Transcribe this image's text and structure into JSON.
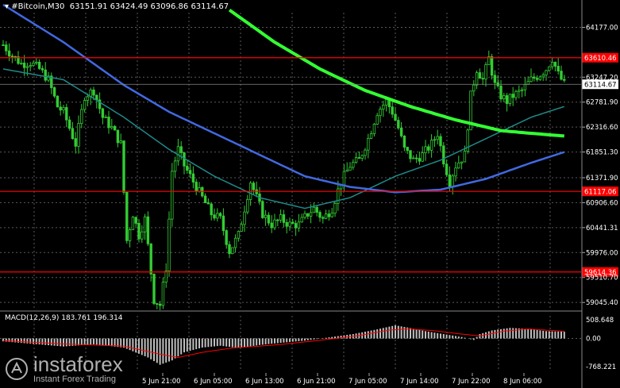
{
  "header": {
    "symbol": "▾ #Bitcoin,M30",
    "ohlc": "63151.91 63424.49 63096.86 63114.67"
  },
  "macd": {
    "label": "MACD(12,26,9)",
    "values": "183.761 196.314"
  },
  "watermark": {
    "brand": "instaforex",
    "tagline": "Instant Forex Trading"
  },
  "colors": {
    "background": "#000000",
    "bull": "#33cc33",
    "ma_fast": "#1f8a8a",
    "ma_mid": "#4169e1",
    "ma_slow": "#33ff33",
    "level": "#ff0000",
    "grid": "#5a5a5a",
    "macd_hist": "#c0c0c0",
    "macd_signal": "#ff0000"
  },
  "chart_data": {
    "type": "candlestick",
    "title": "#Bitcoin,M30",
    "x_ticks": [
      "5 Jun 21:00",
      "6 Jun 05:00",
      "6 Jun 13:00",
      "6 Jun 21:00",
      "7 Jun 05:00",
      "7 Jun 14:00",
      "7 Jun 22:00",
      "8 Jun 06:00"
    ],
    "y_ticks": [
      64177.0,
      63247.2,
      62781.9,
      62316.6,
      61851.3,
      61371.9,
      60906.6,
      60441.31,
      59976.0,
      59510.7,
      59045.4
    ],
    "ylim": [
      58900,
      64450
    ],
    "levels": [
      {
        "label": "63610.46",
        "value": 63610.46
      },
      {
        "label": "61117.06",
        "value": 61117.06
      },
      {
        "label": "59614.36",
        "value": 59614.36
      }
    ],
    "current_price": {
      "label": "63114.67",
      "value": 63114.67
    },
    "grid": true,
    "candles_note": "M30 candles approx. 165 bars",
    "price_path": [
      [
        0,
        63850
      ],
      [
        3,
        63650
      ],
      [
        6,
        63500
      ],
      [
        9,
        63520
      ],
      [
        12,
        63400
      ],
      [
        15,
        63200
      ],
      [
        18,
        62700
      ],
      [
        20,
        62600
      ],
      [
        22,
        62300
      ],
      [
        24,
        62000
      ],
      [
        27,
        62900
      ],
      [
        30,
        63000
      ],
      [
        33,
        62500
      ],
      [
        36,
        62300
      ],
      [
        39,
        62000
      ],
      [
        41,
        60200
      ],
      [
        43,
        60700
      ],
      [
        45,
        60300
      ],
      [
        47,
        60600
      ],
      [
        50,
        59100
      ],
      [
        52,
        59000
      ],
      [
        54,
        59700
      ],
      [
        56,
        61500
      ],
      [
        58,
        61900
      ],
      [
        60,
        61600
      ],
      [
        63,
        61300
      ],
      [
        66,
        61000
      ],
      [
        69,
        60700
      ],
      [
        72,
        60600
      ],
      [
        75,
        60000
      ],
      [
        78,
        60300
      ],
      [
        80,
        60800
      ],
      [
        82,
        61300
      ],
      [
        84,
        61000
      ],
      [
        86,
        60700
      ],
      [
        89,
        60500
      ],
      [
        92,
        60600
      ],
      [
        95,
        60500
      ],
      [
        98,
        60500
      ],
      [
        101,
        60700
      ],
      [
        103,
        60800
      ],
      [
        106,
        60600
      ],
      [
        109,
        60800
      ],
      [
        112,
        61300
      ],
      [
        115,
        61600
      ],
      [
        118,
        61700
      ],
      [
        121,
        62100
      ],
      [
        124,
        62600
      ],
      [
        127,
        62800
      ],
      [
        129,
        62600
      ],
      [
        131,
        62300
      ],
      [
        133,
        61900
      ],
      [
        136,
        61700
      ],
      [
        139,
        61800
      ],
      [
        142,
        62000
      ],
      [
        144,
        62200
      ],
      [
        146,
        61700
      ],
      [
        148,
        61300
      ],
      [
        150,
        61600
      ],
      [
        153,
        61800
      ],
      [
        155,
        62900
      ],
      [
        157,
        63400
      ],
      [
        159,
        63200
      ],
      [
        161,
        63600
      ],
      [
        163,
        63100
      ],
      [
        165,
        62900
      ],
      [
        167,
        62800
      ],
      [
        169,
        62900
      ],
      [
        172,
        63000
      ],
      [
        175,
        63200
      ],
      [
        178,
        63300
      ],
      [
        180,
        63400
      ],
      [
        182,
        63600
      ],
      [
        184,
        63300
      ],
      [
        186,
        63114
      ]
    ],
    "series": [
      {
        "name": "MA fast",
        "values": [
          [
            0,
            63400
          ],
          [
            20,
            63200
          ],
          [
            40,
            62500
          ],
          [
            55,
            61900
          ],
          [
            70,
            61400
          ],
          [
            85,
            61000
          ],
          [
            100,
            60800
          ],
          [
            115,
            61000
          ],
          [
            130,
            61400
          ],
          [
            145,
            61700
          ],
          [
            160,
            62100
          ],
          [
            175,
            62500
          ],
          [
            186,
            62700
          ]
        ]
      },
      {
        "name": "MA mid",
        "values": [
          [
            0,
            64600
          ],
          [
            20,
            63900
          ],
          [
            40,
            63100
          ],
          [
            55,
            62600
          ],
          [
            70,
            62200
          ],
          [
            85,
            61800
          ],
          [
            100,
            61400
          ],
          [
            115,
            61200
          ],
          [
            130,
            61100
          ],
          [
            145,
            61150
          ],
          [
            160,
            61350
          ],
          [
            175,
            61650
          ],
          [
            186,
            61850
          ]
        ]
      },
      {
        "name": "MA slow",
        "values": [
          [
            75,
            64500
          ],
          [
            90,
            63900
          ],
          [
            105,
            63400
          ],
          [
            120,
            63000
          ],
          [
            135,
            62700
          ],
          [
            150,
            62450
          ],
          [
            165,
            62250
          ],
          [
            175,
            62200
          ],
          [
            186,
            62150
          ]
        ]
      }
    ],
    "macd_panel": {
      "y_ticks": [
        508.648,
        0.0,
        -768.221
      ],
      "ylim": [
        -900,
        620
      ],
      "histogram": [
        [
          0,
          -80
        ],
        [
          10,
          -150
        ],
        [
          20,
          -220
        ],
        [
          30,
          -160
        ],
        [
          40,
          -250
        ],
        [
          48,
          -520
        ],
        [
          52,
          -720
        ],
        [
          56,
          -600
        ],
        [
          60,
          -380
        ],
        [
          66,
          -250
        ],
        [
          72,
          -200
        ],
        [
          78,
          -260
        ],
        [
          85,
          -180
        ],
        [
          92,
          -120
        ],
        [
          100,
          -60
        ],
        [
          108,
          30
        ],
        [
          116,
          120
        ],
        [
          124,
          250
        ],
        [
          130,
          360
        ],
        [
          134,
          300
        ],
        [
          140,
          200
        ],
        [
          146,
          120
        ],
        [
          152,
          40
        ],
        [
          156,
          -40
        ],
        [
          158,
          120
        ],
        [
          162,
          220
        ],
        [
          168,
          290
        ],
        [
          174,
          260
        ],
        [
          180,
          200
        ],
        [
          186,
          184
        ]
      ],
      "signal": [
        [
          0,
          -60
        ],
        [
          20,
          -150
        ],
        [
          40,
          -210
        ],
        [
          52,
          -430
        ],
        [
          58,
          -520
        ],
        [
          66,
          -380
        ],
        [
          76,
          -260
        ],
        [
          90,
          -180
        ],
        [
          104,
          -60
        ],
        [
          118,
          80
        ],
        [
          128,
          230
        ],
        [
          134,
          260
        ],
        [
          142,
          220
        ],
        [
          152,
          120
        ],
        [
          158,
          70
        ],
        [
          166,
          200
        ],
        [
          174,
          260
        ],
        [
          186,
          196
        ]
      ]
    }
  }
}
